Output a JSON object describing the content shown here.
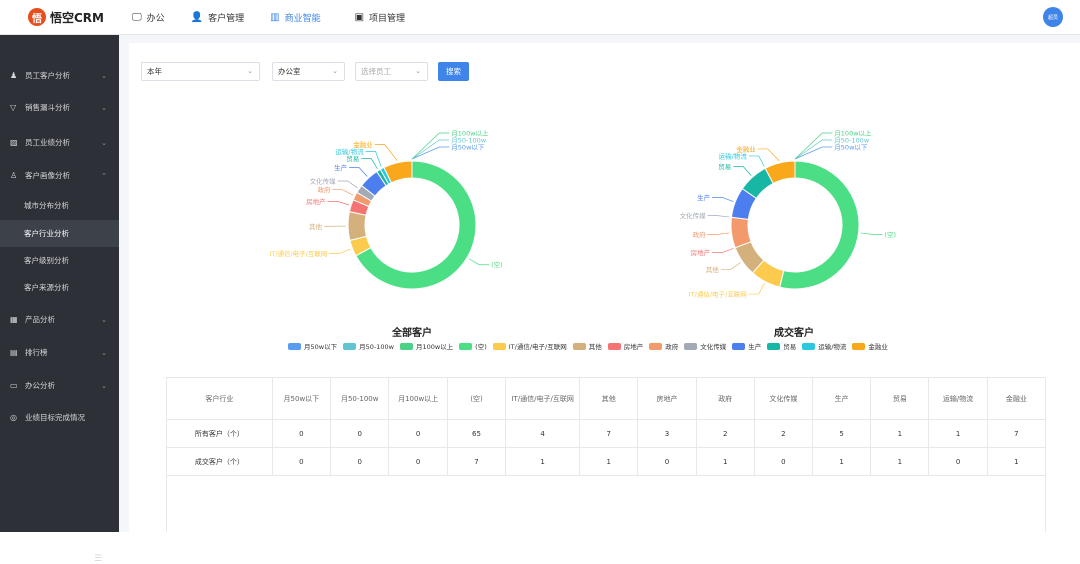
{
  "app": {
    "logo_mark": "悟",
    "logo_text": "悟空CRM",
    "avatar_text": "超员"
  },
  "topnav": [
    {
      "icon": "monitor-icon",
      "glyph": "🖵",
      "label": "办公",
      "active": false
    },
    {
      "icon": "users-icon",
      "glyph": "👤",
      "label": "客户管理",
      "active": false
    },
    {
      "icon": "bar-chart-icon",
      "glyph": "▥",
      "label": "商业智能",
      "active": true
    },
    {
      "icon": "briefcase-icon",
      "glyph": "▣",
      "label": "项目管理",
      "active": false
    }
  ],
  "sidebar": {
    "groups": [
      {
        "label": "员工客户分析",
        "glyph": "♟",
        "icon": "user-group-icon"
      },
      {
        "label": "销售漏斗分析",
        "glyph": "▽",
        "icon": "funnel-icon"
      },
      {
        "label": "员工业绩分析",
        "glyph": "▨",
        "icon": "image-icon"
      },
      {
        "label": "客户画像分析",
        "glyph": "♙",
        "icon": "portrait-icon"
      },
      {
        "label": "产品分析",
        "glyph": "▦",
        "icon": "grid-icon"
      },
      {
        "label": "排行榜",
        "glyph": "▤",
        "icon": "ranking-icon"
      },
      {
        "label": "办公分析",
        "glyph": "▭",
        "icon": "office-icon"
      },
      {
        "label": "业绩目标完成情况",
        "glyph": "◎",
        "icon": "target-icon"
      }
    ],
    "subitems": [
      "城市分布分析",
      "客户行业分析",
      "客户级别分析",
      "客户来源分析"
    ],
    "active_sub": "客户行业分析"
  },
  "filters": {
    "year": "本年",
    "department": "办公室",
    "employee_placeholder": "选择员工",
    "search_label": "搜索"
  },
  "colors": {
    "月50w以下": "#5b9cf3",
    "月50-100w": "#60c5d0",
    "月100w以上": "#4bd185",
    "(空)": "#4cde84",
    "IT/通信/电子/互联网": "#fccb4d",
    "其他": "#d4b07c",
    "房地产": "#f57373",
    "政府": "#f39a6c",
    "文化传媒": "#a2aab5",
    "生产": "#4c7ef0",
    "贸易": "#18b6a4",
    "运输/物流": "#2cc8e0",
    "金融业": "#f9a71b"
  },
  "chart_data": [
    {
      "type": "pie",
      "title": "全部客户",
      "categories": [
        "月50w以下",
        "月50-100w",
        "月100w以上",
        "(空)",
        "IT/通信/电子/互联网",
        "其他",
        "房地产",
        "政府",
        "文化传媒",
        "生产",
        "贸易",
        "运输/物流",
        "金融业"
      ],
      "values": [
        0,
        0,
        0,
        65,
        4,
        7,
        3,
        2,
        2,
        5,
        1,
        1,
        7
      ]
    },
    {
      "type": "pie",
      "title": "成交客户",
      "categories": [
        "月50w以下",
        "月50-100w",
        "月100w以上",
        "(空)",
        "IT/通信/电子/互联网",
        "其他",
        "房地产",
        "政府",
        "文化传媒",
        "生产",
        "贸易",
        "运输/物流",
        "金融业"
      ],
      "values": [
        0,
        0,
        0,
        7,
        1,
        1,
        0,
        1,
        0,
        1,
        1,
        0,
        1
      ]
    }
  ],
  "legend_labels": [
    "月50w以下",
    "月50-100w",
    "月100w以上",
    "(空)",
    "IT/通信/电子/互联网",
    "其他",
    "房地产",
    "政府",
    "文化传媒",
    "生产",
    "贸易",
    "运输/物流",
    "金融业"
  ],
  "table": {
    "corner": "客户行业",
    "headers": [
      "月50w以下",
      "月50-100w",
      "月100w以上",
      "(空)",
      "IT/通信/电子/互联网",
      "其他",
      "房地产",
      "政府",
      "文化传媒",
      "生产",
      "贸易",
      "运输/物流",
      "金融业"
    ],
    "rows": [
      {
        "label": "所有客户（个）",
        "values": [
          "0",
          "0",
          "0",
          "65",
          "4",
          "7",
          "3",
          "2",
          "2",
          "5",
          "1",
          "1",
          "7"
        ]
      },
      {
        "label": "成交客户（个）",
        "values": [
          "0",
          "0",
          "0",
          "7",
          "1",
          "1",
          "0",
          "1",
          "0",
          "1",
          "1",
          "0",
          "1"
        ]
      }
    ]
  }
}
